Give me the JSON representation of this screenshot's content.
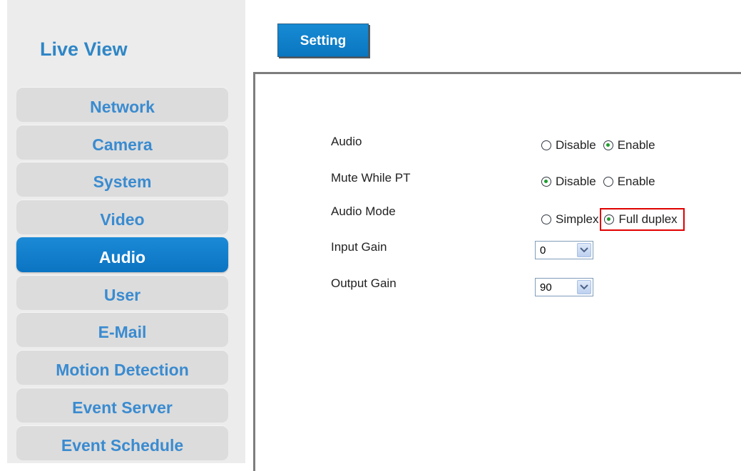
{
  "sidebar": {
    "live_view": "Live View",
    "items": [
      {
        "label": "Network",
        "active": false
      },
      {
        "label": "Camera",
        "active": false
      },
      {
        "label": "System",
        "active": false
      },
      {
        "label": "Video",
        "active": false
      },
      {
        "label": "Audio",
        "active": true
      },
      {
        "label": "User",
        "active": false
      },
      {
        "label": "E-Mail",
        "active": false
      },
      {
        "label": "Motion Detection",
        "active": false
      },
      {
        "label": "Event Server",
        "active": false
      },
      {
        "label": "Event Schedule",
        "active": false
      }
    ]
  },
  "tab": {
    "label": "Setting"
  },
  "settings": {
    "audio": {
      "label": "Audio",
      "options": [
        "Disable",
        "Enable"
      ],
      "selected": "Enable"
    },
    "mute_while_pt": {
      "label": "Mute While PT",
      "options": [
        "Disable",
        "Enable"
      ],
      "selected": "Disable"
    },
    "audio_mode": {
      "label": "Audio Mode",
      "options": [
        "Simplex",
        "Full duplex"
      ],
      "selected": "Full duplex",
      "highlighted": "Full duplex"
    },
    "input_gain": {
      "label": "Input Gain",
      "value": "0"
    },
    "output_gain": {
      "label": "Output Gain",
      "value": "90"
    }
  },
  "colors": {
    "nav_text": "#3a8bd0",
    "nav_active_bg": "#0b7ec9",
    "highlight_border": "#e00000",
    "radio_checked": "#1f9d2e"
  }
}
